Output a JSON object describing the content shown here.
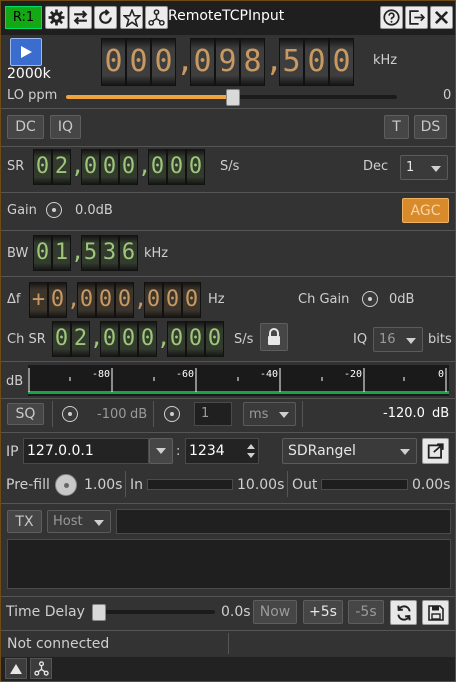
{
  "title": {
    "rx_tag": "R:1",
    "name": "RemoteTCPInput",
    "icons": [
      "gear-icon",
      "swap-icon",
      "reload-icon",
      "star-icon",
      "network-icon",
      "help-icon",
      "undock-icon",
      "close-icon"
    ]
  },
  "center_freq": {
    "play_icon": "play-icon",
    "rate_label": "2000k",
    "display": "000,098,500",
    "unit": "kHz"
  },
  "lo_ppm": {
    "label": "LO ppm",
    "value": "0",
    "level": 0.5
  },
  "toggles": {
    "dc": "DC",
    "iq": "IQ",
    "t": "T",
    "ds": "DS"
  },
  "sample_rate": {
    "label": "SR",
    "display": "02,000,000",
    "unit": "S/s",
    "dec_label": "Dec",
    "dec_value": "1"
  },
  "gain": {
    "label": "Gain",
    "value": "0.0dB",
    "agc": "AGC"
  },
  "bandwidth": {
    "label": "BW",
    "display": "01,536",
    "unit": "kHz"
  },
  "offset": {
    "label": "Δf",
    "display": "+0,000,000",
    "unit": "Hz",
    "ch_gain_label": "Ch Gain",
    "ch_gain_value": "0dB"
  },
  "ch_sr": {
    "label": "Ch SR",
    "display": "02,000,000",
    "unit": "S/s",
    "iq_label": "IQ",
    "iq_value": "16",
    "bits": "bits"
  },
  "level_meter": {
    "label": "dB",
    "ticks": [
      "-80",
      "-60",
      "-40",
      "-20",
      "0"
    ],
    "green_level": 1.0
  },
  "squelch": {
    "sq": "SQ",
    "threshold": "-100",
    "threshold_unit": "dB",
    "gate": "1",
    "gate_unit": "ms",
    "power": "-120.0",
    "power_unit": "dB"
  },
  "connection": {
    "ip_label": "IP",
    "ip": "127.0.0.1",
    "colon": ":",
    "port": "1234",
    "protocol": "SDRangel"
  },
  "buffers": {
    "prefill_label": "Pre-fill",
    "prefill_value": "1.00s",
    "in_label": "In",
    "in_value": "10.00s",
    "out_label": "Out",
    "out_value": "0.00s"
  },
  "tx": {
    "tx": "TX",
    "target": "Host",
    "message": ""
  },
  "time_delay": {
    "label": "Time Delay",
    "value": "0.0s",
    "now": "Now",
    "plus": "+5s",
    "minus": "-5s"
  },
  "status": {
    "text": "Not connected"
  }
}
